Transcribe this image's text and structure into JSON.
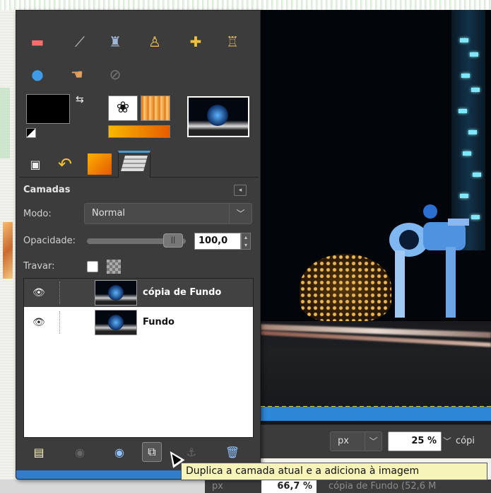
{
  "toolbox": {
    "tools": [
      {
        "icon": "eraser-icon",
        "glyph": "▬"
      },
      {
        "icon": "airbrush-icon",
        "glyph": "⟋"
      },
      {
        "icon": "ink-icon",
        "glyph": "♜"
      },
      {
        "icon": "clone-icon",
        "glyph": "♙"
      },
      {
        "icon": "heal-icon",
        "glyph": "✚"
      },
      {
        "icon": "perspective-clone-icon",
        "glyph": "♖"
      },
      {
        "icon": "blur-icon",
        "glyph": "💧"
      },
      {
        "icon": "smudge-icon",
        "glyph": "☚"
      },
      {
        "icon": "dodge-burn-icon",
        "glyph": "⊘"
      }
    ],
    "colors": {
      "foreground": "#000000",
      "background": "#ffffff"
    }
  },
  "tabs": [
    {
      "icon": "device-status-icon",
      "glyph": "▣"
    },
    {
      "icon": "undo-history-icon",
      "glyph": "↶"
    },
    {
      "icon": "pattern-tab-icon",
      "glyph": "■"
    },
    {
      "icon": "layers-tab-icon",
      "glyph": "▤"
    }
  ],
  "layers_panel": {
    "title": "Camadas",
    "mode_label": "Modo:",
    "mode_value": "Normal",
    "opacity_label": "Opacidade:",
    "opacity_value": "100,0",
    "lock_label": "Travar:",
    "layers": [
      {
        "name": "cópia de Fundo",
        "selected": true
      },
      {
        "name": "Fundo",
        "selected": false
      }
    ]
  },
  "canvas_bar": {
    "unit": "px",
    "zoom": "25 %",
    "status": "cópi"
  },
  "lower_bar": {
    "unit": "px",
    "zoom": "66,7 %",
    "status": "cópia de Fundo (52,6 M"
  },
  "tooltip": "Duplica a camada atual e a adiciona à imagem",
  "accent": "#4a9ad6"
}
